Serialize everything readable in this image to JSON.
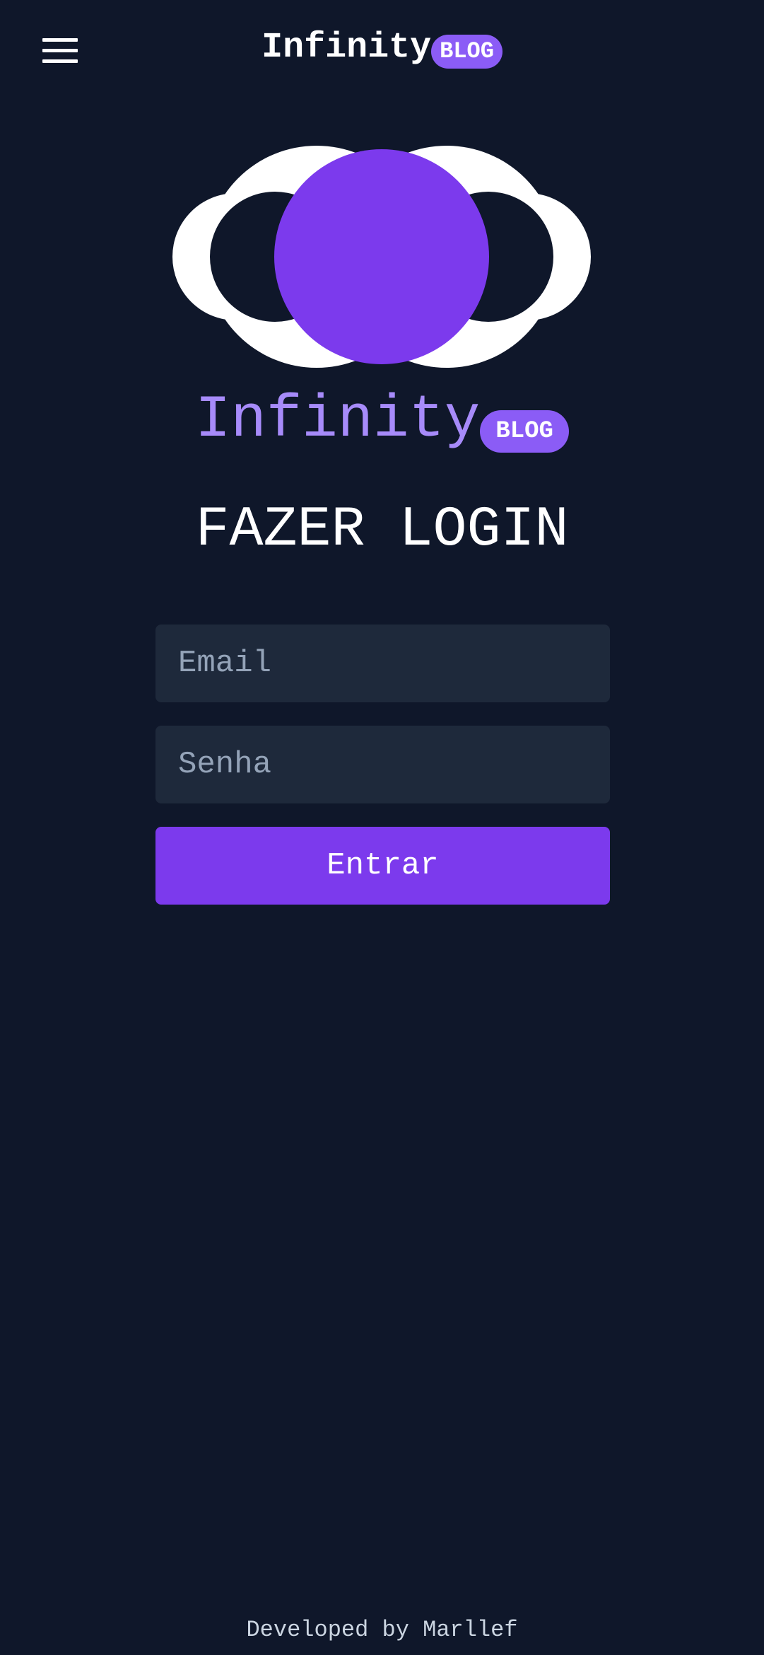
{
  "header": {
    "brand_name": "Infinity",
    "brand_badge": "BLOG",
    "menu_icon": "hamburger-menu-icon"
  },
  "hero": {
    "logo_icon": "infinity-logo-icon",
    "brand_name": "Infinity",
    "brand_badge": "BLOG"
  },
  "login": {
    "title": "FAZER LOGIN",
    "email_placeholder": "Email",
    "password_placeholder": "Senha",
    "submit_label": "Entrar"
  },
  "footer": {
    "credit": "Developed by Marllef"
  },
  "colors": {
    "background": "#0f172a",
    "input_background": "#1e293b",
    "accent": "#7c3aed",
    "badge": "#8b5cf6",
    "brand_text": "#a78bfa"
  }
}
